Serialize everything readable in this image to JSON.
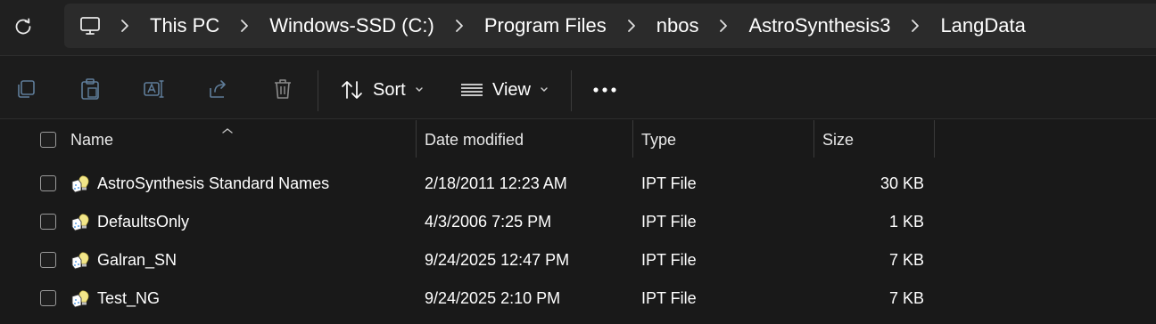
{
  "breadcrumb": {
    "items": [
      "This PC",
      "Windows-SSD (C:)",
      "Program Files",
      "nbos",
      "AstroSynthesis3",
      "LangData"
    ]
  },
  "toolbar": {
    "sort_label": "Sort",
    "view_label": "View"
  },
  "columns": {
    "name": "Name",
    "date": "Date modified",
    "type": "Type",
    "size": "Size"
  },
  "files": [
    {
      "name": "AstroSynthesis Standard Names",
      "date": "2/18/2011 12:23 AM",
      "type": "IPT File",
      "size": "30 KB"
    },
    {
      "name": "DefaultsOnly",
      "date": "4/3/2006 7:25 PM",
      "type": "IPT File",
      "size": "1 KB"
    },
    {
      "name": "Galran_SN",
      "date": "9/24/2025 12:47 PM",
      "type": "IPT File",
      "size": "7 KB"
    },
    {
      "name": "Test_NG",
      "date": "9/24/2025 2:10 PM",
      "type": "IPT File",
      "size": "7 KB"
    }
  ],
  "colors": {
    "background": "#191919",
    "address_box": "#2b2b2b",
    "accent_icon": "#5aa0e6"
  }
}
